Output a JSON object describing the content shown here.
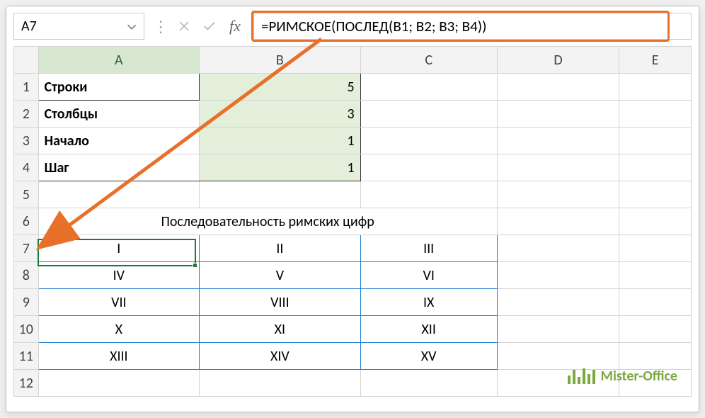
{
  "name_box": {
    "value": "A7"
  },
  "formula_bar": {
    "text": "=РИМСКОЕ(ПОСЛЕД(B1; B2; B3; B4))"
  },
  "columns": [
    "A",
    "B",
    "C",
    "D",
    "E"
  ],
  "rows": [
    "1",
    "2",
    "3",
    "4",
    "5",
    "6",
    "7",
    "8",
    "9",
    "10",
    "11",
    "12"
  ],
  "params": {
    "labels": {
      "rows": "Строки",
      "cols": "Столбцы",
      "start": "Начало",
      "step": "Шаг"
    },
    "values": {
      "rows": "5",
      "cols": "3",
      "start": "1",
      "step": "1"
    }
  },
  "title_row": "Последовательность римских цифр",
  "seq": [
    [
      "I",
      "II",
      "III"
    ],
    [
      "IV",
      "V",
      "VI"
    ],
    [
      "VII",
      "VIII",
      "IX"
    ],
    [
      "X",
      "XI",
      "XII"
    ],
    [
      "XIII",
      "XIV",
      "XV"
    ]
  ],
  "watermark": {
    "text": "Mister-Office"
  }
}
